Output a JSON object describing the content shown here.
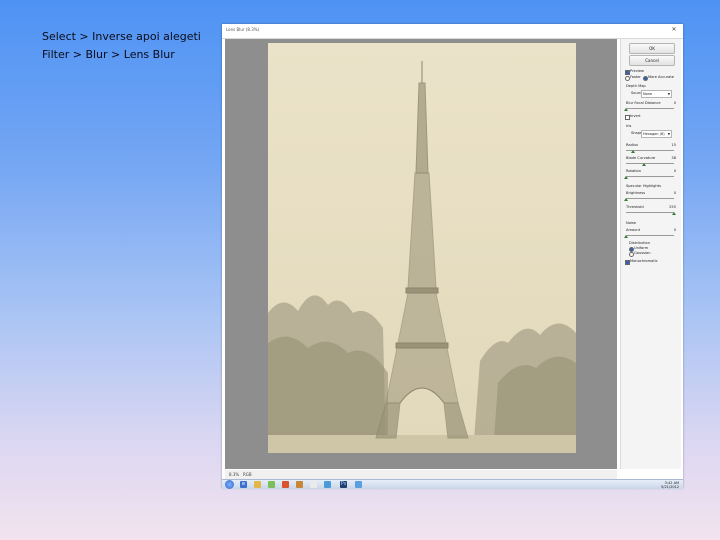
{
  "caption": "Select > Inverse apoi alegeti Filter > Blur > Lens Blur",
  "window": {
    "title": "Lens Blur (8.3%)"
  },
  "buttons": {
    "ok": "OK",
    "cancel": "Cancel"
  },
  "panel": {
    "preview_label": "Preview",
    "faster_label": "Faster",
    "more_accurate_label": "More Accurate",
    "depth_map_label": "Depth Map",
    "source_label": "Source:",
    "source_value": "None",
    "blur_focal_label": "Blur Focal Distance",
    "blur_focal_value": "0",
    "invert_label": "Invert",
    "iris_label": "Iris",
    "shape_label": "Shape:",
    "shape_value": "Hexagon (6)",
    "radius_label": "Radius",
    "radius_value": "15",
    "blade_label": "Blade Curvature",
    "blade_value": "38",
    "rotation_label": "Rotation",
    "rotation_value": "0",
    "specular_label": "Specular Highlights",
    "brightness_label": "Brightness",
    "brightness_value": "0",
    "threshold_label": "Threshold",
    "threshold_value": "255",
    "noise_label": "Noise",
    "amount_label": "Amount",
    "amount_value": "0",
    "distribution_label": "Distribution",
    "uniform_label": "Uniform",
    "gaussian_label": "Gaussian",
    "monochromatic_label": "Monochromatic"
  },
  "statusbar": {
    "zoom": "8.3%",
    "mode": "RGB"
  },
  "taskbar": {
    "time": "3:42 AM",
    "date": "5/21/2012"
  },
  "sliders": {
    "blur_focal": 0,
    "radius": 0.15,
    "blade": 0.38,
    "rotation": 0,
    "brightness": 0,
    "threshold": 1,
    "amount": 0
  },
  "colors": {
    "accent": "#3a5fb0",
    "desktop_top": "#4e93f4",
    "photo_sepia": "#e6ddc2"
  }
}
